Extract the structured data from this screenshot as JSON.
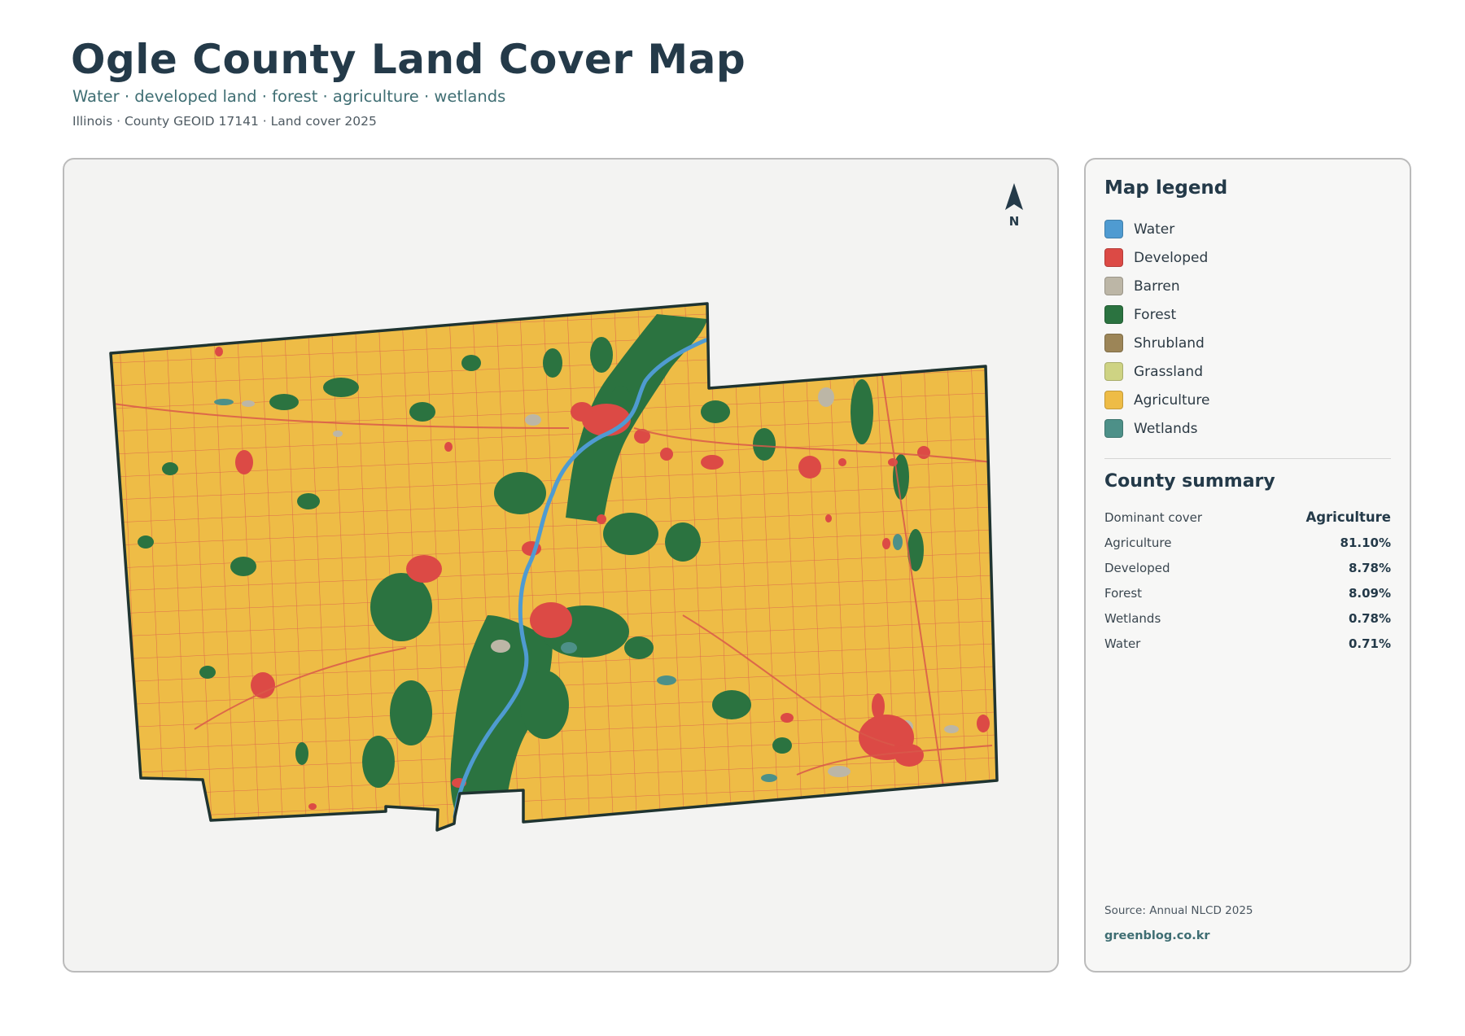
{
  "header": {
    "title": "Ogle County Land Cover Map",
    "subtitle": "Water · developed land · forest · agriculture · wetlands",
    "meta": "Illinois · County GEOID 17141 · Land cover 2025"
  },
  "map": {
    "north_label": "N",
    "colors": {
      "water": "#4f9bd1",
      "developed": "#dc4a45",
      "barren": "#bcb6a6",
      "forest": "#2b7340",
      "shrubland": "#9c8557",
      "grassland": "#ced383",
      "agriculture": "#eebc46",
      "wetlands": "#4d9088",
      "roads": "#d9594a",
      "boundary": "#1f3431",
      "panel_bg": "#f3f3f2"
    }
  },
  "legend": {
    "title": "Map legend",
    "items": [
      {
        "label": "Water",
        "color": "#4f9bd1"
      },
      {
        "label": "Developed",
        "color": "#dc4a45"
      },
      {
        "label": "Barren",
        "color": "#bcb6a6"
      },
      {
        "label": "Forest",
        "color": "#2b7340"
      },
      {
        "label": "Shrubland",
        "color": "#9c8557"
      },
      {
        "label": "Grassland",
        "color": "#ced383"
      },
      {
        "label": "Agriculture",
        "color": "#eebc46"
      },
      {
        "label": "Wetlands",
        "color": "#4d9088"
      }
    ]
  },
  "summary": {
    "title": "County summary",
    "dominant": {
      "label": "Dominant cover",
      "value": "Agriculture"
    },
    "rows": [
      {
        "label": "Agriculture",
        "value": "81.10%"
      },
      {
        "label": "Developed",
        "value": "8.78%"
      },
      {
        "label": "Forest",
        "value": "8.09%"
      },
      {
        "label": "Wetlands",
        "value": "0.78%"
      },
      {
        "label": "Water",
        "value": "0.71%"
      }
    ],
    "source": "Source: Annual NLCD 2025",
    "site": "greenblog.co.kr"
  }
}
